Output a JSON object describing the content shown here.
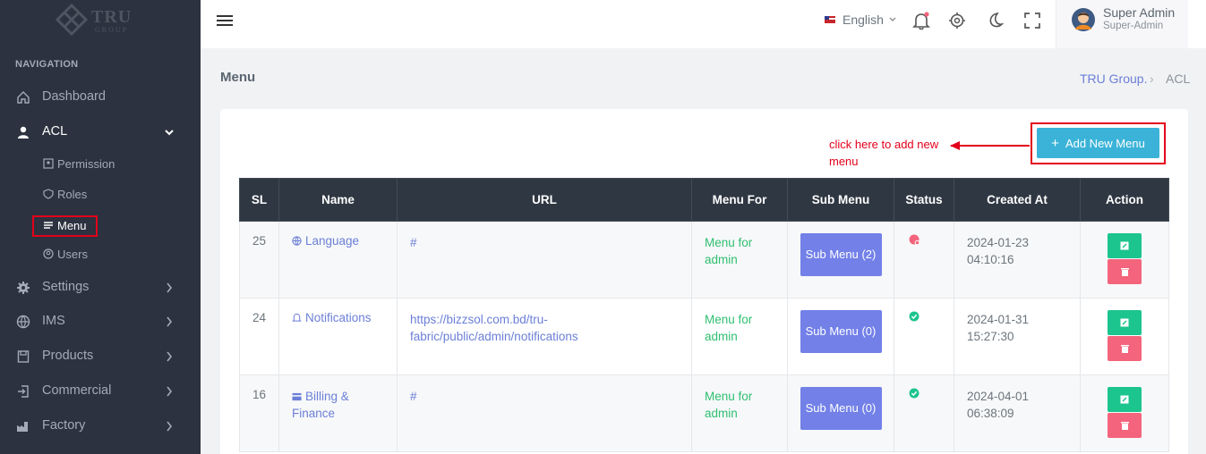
{
  "brand": {
    "name": "TRU",
    "sub": "GROUP"
  },
  "sidebar": {
    "heading": "NAVIGATION",
    "items": [
      {
        "label": "Dashboard"
      },
      {
        "label": "ACL"
      },
      {
        "label": "Settings"
      },
      {
        "label": "IMS"
      },
      {
        "label": "Products"
      },
      {
        "label": "Commercial"
      },
      {
        "label": "Factory"
      }
    ],
    "acl_sub": [
      {
        "label": "Permission"
      },
      {
        "label": "Roles"
      },
      {
        "label": "Menu"
      },
      {
        "label": "Users"
      }
    ]
  },
  "topbar": {
    "language": "English",
    "user_name": "Super Admin",
    "user_role": "Super-Admin"
  },
  "page": {
    "title": "Menu",
    "breadcrumb": [
      "TRU Group.",
      "ACL"
    ]
  },
  "card": {
    "add_button": "Add New Menu",
    "annotation": "click here to add new menu"
  },
  "table": {
    "headers": [
      "SL",
      "Name",
      "URL",
      "Menu For",
      "Sub Menu",
      "Status",
      "Created At",
      "Action"
    ],
    "rows": [
      {
        "sl": "25",
        "name": "Language",
        "url": "#",
        "menu_for": "Menu for admin",
        "sub_menu": "Sub Menu (2)",
        "created": "2024-01-23 04:10:16",
        "status": "inactive"
      },
      {
        "sl": "24",
        "name": "Notifications",
        "url": "https://bizzsol.com.bd/tru-fabric/public/admin/notifications",
        "menu_for": "Menu for admin",
        "sub_menu": "Sub Menu (0)",
        "created": "2024-01-31 15:27:30",
        "status": "active"
      },
      {
        "sl": "16",
        "name": "Billing & Finance",
        "url": "#",
        "menu_for": "Menu for admin",
        "sub_menu": "Sub Menu (0)",
        "created": "2024-04-01 06:38:09",
        "status": "active"
      }
    ]
  },
  "colors": {
    "accent": "#3bb3d8",
    "highlight": "#e3001b",
    "sidebar": "#2c323f",
    "success": "#1cc48e",
    "danger": "#f4647c"
  }
}
